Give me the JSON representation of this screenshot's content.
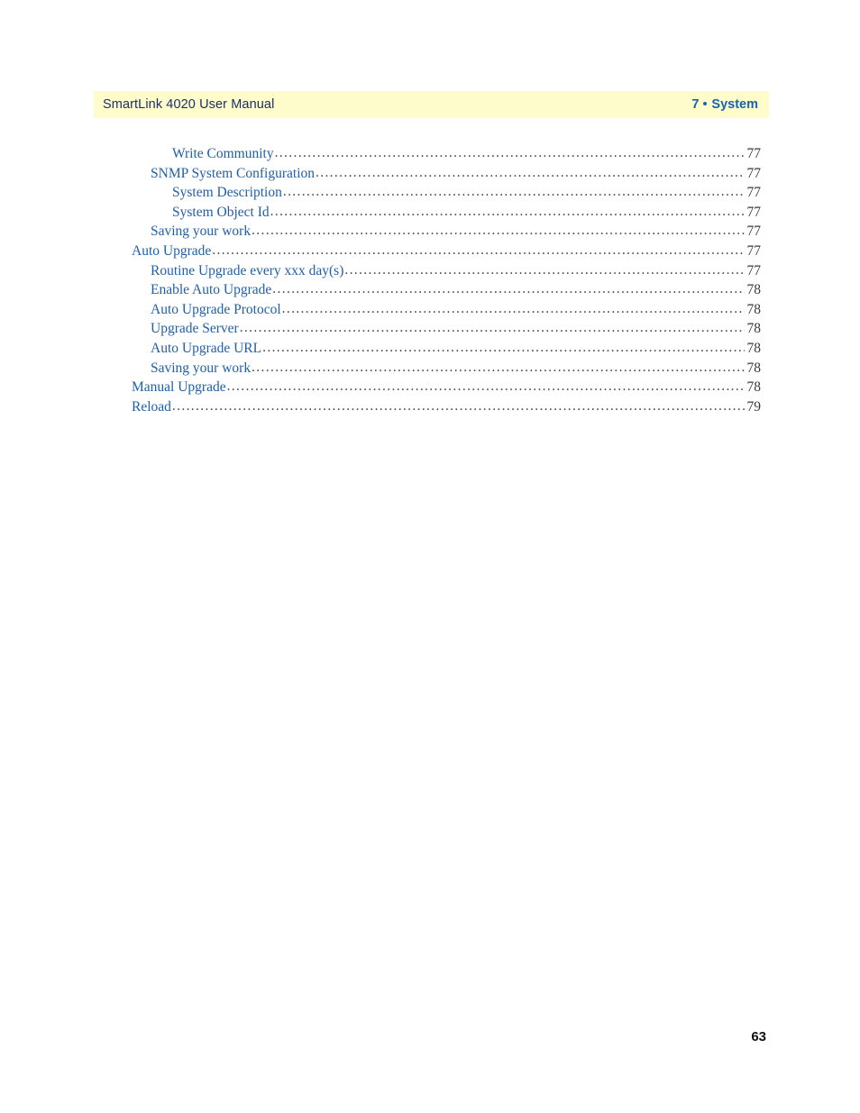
{
  "header": {
    "manual_title": "SmartLink 4020 User Manual",
    "chapter_number": "7",
    "chapter_name": "System",
    "band_color": "#fffccc",
    "title_color": "#1a2f6b",
    "chapter_color": "#1763b0"
  },
  "toc": {
    "entry_color": "#1f5fa8",
    "leader_color": "#4a4a4a",
    "entries": [
      {
        "label": "Write Community",
        "page": "77",
        "level": 2,
        "space_before_leader": true
      },
      {
        "label": "SNMP System Configuration",
        "page": "77",
        "level": 1,
        "space_before_leader": true
      },
      {
        "label": "System Description",
        "page": "77",
        "level": 2,
        "space_before_leader": true
      },
      {
        "label": "System Object Id",
        "page": "77",
        "level": 2,
        "space_before_leader": false
      },
      {
        "label": "Saving your work",
        "page": "77",
        "level": 1,
        "space_before_leader": true
      },
      {
        "label": "Auto Upgrade",
        "page": "77",
        "level": 0,
        "space_before_leader": false
      },
      {
        "label": "Routine Upgrade every xxx day(s)",
        "page": "77",
        "level": 1,
        "space_before_leader": true
      },
      {
        "label": "Enable Auto Upgrade",
        "page": "78",
        "level": 1,
        "space_before_leader": true
      },
      {
        "label": "Auto Upgrade Protocol",
        "page": "78",
        "level": 1,
        "space_before_leader": true
      },
      {
        "label": "Upgrade Server",
        "page": "78",
        "level": 1,
        "space_before_leader": true
      },
      {
        "label": "Auto Upgrade URL",
        "page": "78",
        "level": 1,
        "space_before_leader": true
      },
      {
        "label": "Saving your work",
        "page": "78",
        "level": 1,
        "space_before_leader": true
      },
      {
        "label": "Manual Upgrade",
        "page": "78",
        "level": 0,
        "space_before_leader": false
      },
      {
        "label": "Reload",
        "page": "79",
        "level": 0,
        "space_before_leader": false
      }
    ]
  },
  "footer": {
    "page_number": "63"
  }
}
